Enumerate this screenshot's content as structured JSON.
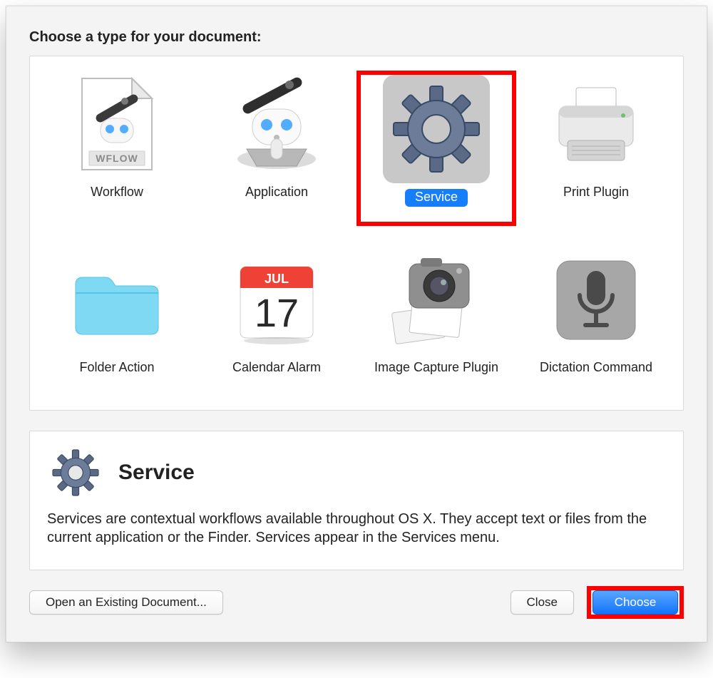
{
  "heading": "Choose a type for your document:",
  "types": [
    {
      "id": "workflow",
      "label": "Workflow",
      "selected": false
    },
    {
      "id": "application",
      "label": "Application",
      "selected": false
    },
    {
      "id": "service",
      "label": "Service",
      "selected": true
    },
    {
      "id": "print-plugin",
      "label": "Print Plugin",
      "selected": false
    },
    {
      "id": "folder-action",
      "label": "Folder Action",
      "selected": false
    },
    {
      "id": "calendar-alarm",
      "label": "Calendar Alarm",
      "selected": false
    },
    {
      "id": "image-capture-plugin",
      "label": "Image Capture Plugin",
      "selected": false
    },
    {
      "id": "dictation-command",
      "label": "Dictation Command",
      "selected": false
    }
  ],
  "calendar": {
    "month": "JUL",
    "day": "17"
  },
  "wflow_tag": "WFLOW",
  "detail": {
    "title": "Service",
    "text": "Services are contextual workflows available throughout OS X. They accept text or files from the current application or the Finder. Services appear in the Services menu."
  },
  "footer": {
    "open_label": "Open an Existing Document...",
    "close_label": "Close",
    "choose_label": "Choose"
  }
}
